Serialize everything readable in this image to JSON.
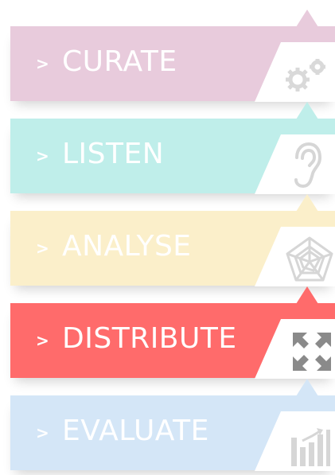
{
  "steps": [
    {
      "label": "CURATE",
      "chevron": ">",
      "color": "#e8cbdc",
      "icon": "gears-icon",
      "accent": "#e8cbdc"
    },
    {
      "label": "LISTEN",
      "chevron": ">",
      "color": "#bfeeea",
      "icon": "ear-icon",
      "accent": "#bfeeea"
    },
    {
      "label": "ANALYSE",
      "chevron": ">",
      "color": "#fbefca",
      "icon": "radar-icon",
      "accent": "#fbefca"
    },
    {
      "label": "DISTRIBUTE",
      "chevron": ">",
      "color": "#ff6b6b",
      "icon": "expand-arrows-icon",
      "accent": "#ff6b6b"
    },
    {
      "label": "EVALUATE",
      "chevron": ">",
      "color": "#d4e6f7",
      "icon": "bar-chart-icon",
      "accent": "#d4e6f7"
    }
  ]
}
